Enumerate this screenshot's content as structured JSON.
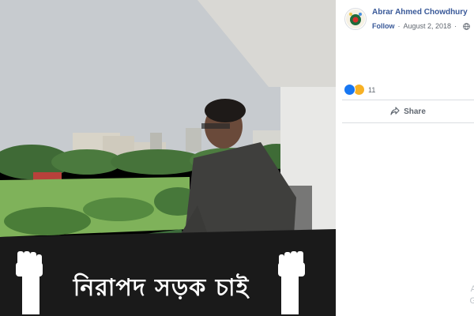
{
  "post": {
    "author": "Abrar Ahmed Chowdhury",
    "follow_label": "Follow",
    "separator": "·",
    "date": "August 2, 2018",
    "reaction_count": "11",
    "share_label": "Share"
  },
  "photo": {
    "banner_text": "নিরাপদ সড়ক চাই"
  },
  "edge": {
    "line1": "A",
    "line2": "G"
  },
  "icons": {
    "avatar": "profile-avatar",
    "like": "like-reaction-icon",
    "sad": "sad-reaction-icon",
    "globe": "globe-icon",
    "share": "share-arrow-icon",
    "fist": "raised-fist-icon"
  },
  "colors": {
    "link_blue": "#385898",
    "meta_grey": "#606770",
    "like_blue": "#1877f2",
    "sad_yellow": "#f7b125",
    "banner_bg": "#1a1a1a"
  }
}
